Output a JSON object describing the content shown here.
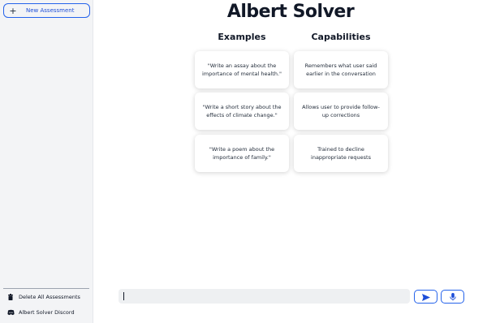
{
  "sidebar": {
    "new_assessment_label": "New Assessment",
    "delete_all_label": "Delete All Assessments",
    "discord_label": "Albert Solver Discord"
  },
  "main": {
    "title": "Albert Solver",
    "examples_heading": "Examples",
    "capabilities_heading": "Capabilities",
    "examples": [
      "\"Write an assay about the importance of mental health.\"",
      "\"Write a short story about the effects of climate change.\"",
      "\"Write a poem about the importance of family.\""
    ],
    "capabilities": [
      "Remembers what user said earlier in the conversation",
      "Allows user to provide follow-up corrections",
      "Trained to decline inappropriate requests"
    ]
  },
  "composer": {
    "input_value": "",
    "send_icon": "send-icon",
    "mic_icon": "microphone-icon"
  },
  "colors": {
    "accent": "#2563eb",
    "sidebar_bg": "#f3f4f6",
    "input_bg": "#eef0f2"
  }
}
